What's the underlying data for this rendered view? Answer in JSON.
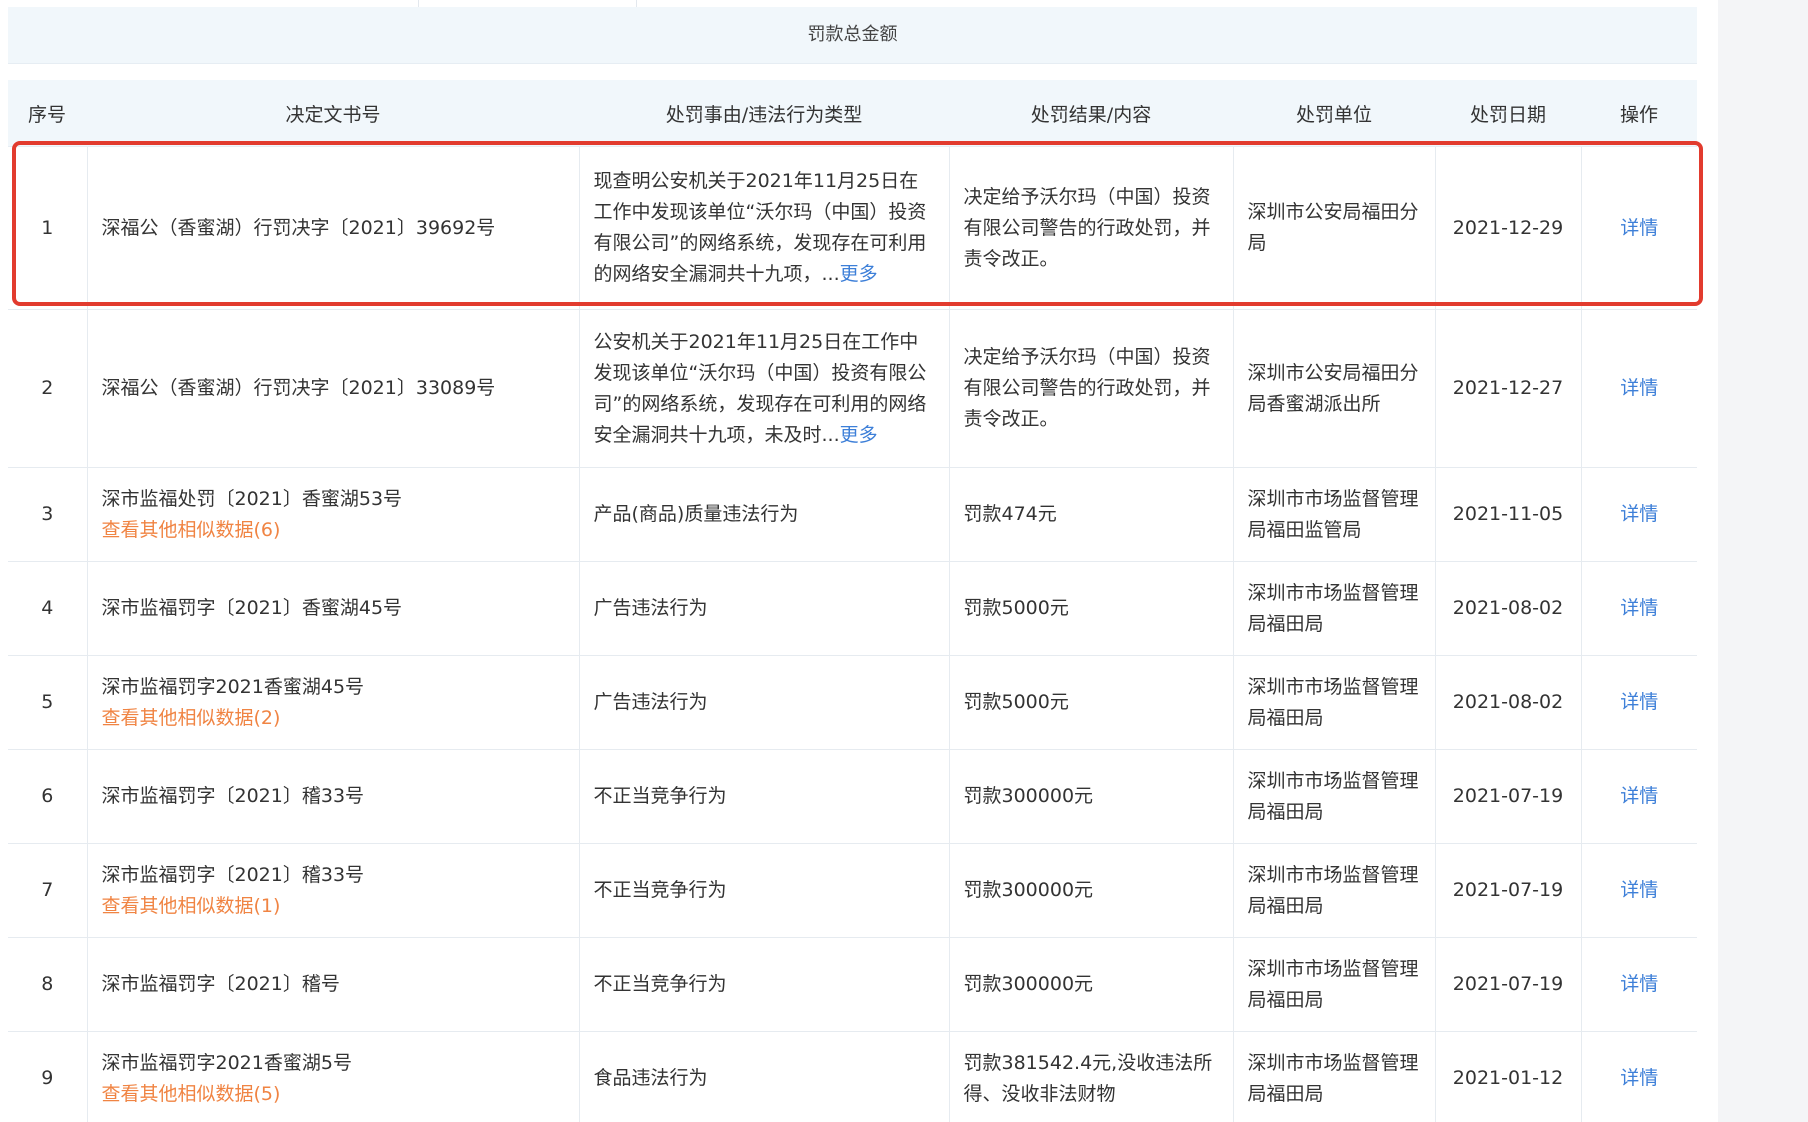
{
  "summary": {
    "total_label": "罚款总金额"
  },
  "table": {
    "headers": {
      "index": "序号",
      "doc_no": "决定文书号",
      "reason": "处罚事由/违法行为类型",
      "result": "处罚结果/内容",
      "unit": "处罚单位",
      "date": "处罚日期",
      "action": "操作"
    },
    "rows": [
      {
        "index": "1",
        "doc_no": "深福公（香蜜湖）行罚决字〔2021〕39692号",
        "similar": "",
        "reason": "现查明公安机关于2021年11月25日在工作中发现该单位“沃尔玛（中国）投资有限公司”的网络系统，发现存在可利用的网络安全漏洞共十九项，",
        "reason_ellipsis": "...",
        "reason_more": "更多",
        "result": "决定给予沃尔玛（中国）投资有限公司警告的行政处罚，并责令改正。",
        "unit": "深圳市公安局福田分局",
        "date": "2021-12-29",
        "action": "详情"
      },
      {
        "index": "2",
        "doc_no": "深福公（香蜜湖）行罚决字〔2021〕33089号",
        "similar": "",
        "reason": "公安机关于2021年11月25日在工作中发现该单位“沃尔玛（中国）投资有限公司”的网络系统，发现存在可利用的网络安全漏洞共十九项，未及时",
        "reason_ellipsis": "...",
        "reason_more": "更多",
        "result": "决定给予沃尔玛（中国）投资有限公司警告的行政处罚，并责令改正。",
        "unit": "深圳市公安局福田分局香蜜湖派出所",
        "date": "2021-12-27",
        "action": "详情"
      },
      {
        "index": "3",
        "doc_no": "深市监福处罚〔2021〕香蜜湖53号",
        "similar": "查看其他相似数据(6)",
        "reason": "产品(商品)质量违法行为",
        "reason_ellipsis": "",
        "reason_more": "",
        "result": "罚款474元",
        "unit": "深圳市市场监督管理局福田监管局",
        "date": "2021-11-05",
        "action": "详情"
      },
      {
        "index": "4",
        "doc_no": "深市监福罚字〔2021〕香蜜湖45号",
        "similar": "",
        "reason": "广告违法行为",
        "reason_ellipsis": "",
        "reason_more": "",
        "result": "罚款5000元",
        "unit": "深圳市市场监督管理局福田局",
        "date": "2021-08-02",
        "action": "详情"
      },
      {
        "index": "5",
        "doc_no": "深市监福罚字2021香蜜湖45号",
        "similar": "查看其他相似数据(2)",
        "reason": "广告违法行为",
        "reason_ellipsis": "",
        "reason_more": "",
        "result": "罚款5000元",
        "unit": "深圳市市场监督管理局福田局",
        "date": "2021-08-02",
        "action": "详情"
      },
      {
        "index": "6",
        "doc_no": "深市监福罚字〔2021〕稽33号",
        "similar": "",
        "reason": "不正当竞争行为",
        "reason_ellipsis": "",
        "reason_more": "",
        "result": "罚款300000元",
        "unit": "深圳市市场监督管理局福田局",
        "date": "2021-07-19",
        "action": "详情"
      },
      {
        "index": "7",
        "doc_no": "深市监福罚字〔2021〕稽33号",
        "similar": "查看其他相似数据(1)",
        "reason": "不正当竞争行为",
        "reason_ellipsis": "",
        "reason_more": "",
        "result": "罚款300000元",
        "unit": "深圳市市场监督管理局福田局",
        "date": "2021-07-19",
        "action": "详情"
      },
      {
        "index": "8",
        "doc_no": "深市监福罚字〔2021〕稽号",
        "similar": "",
        "reason": "不正当竞争行为",
        "reason_ellipsis": "",
        "reason_more": "",
        "result": "罚款300000元",
        "unit": "深圳市市场监督管理局福田局",
        "date": "2021-07-19",
        "action": "详情"
      },
      {
        "index": "9",
        "doc_no": "深市监福罚字2021香蜜湖5号",
        "similar": "查看其他相似数据(5)",
        "reason": "食品违法行为",
        "reason_ellipsis": "",
        "reason_more": "",
        "result": "罚款381542.4元,没收违法所得、没收非法财物",
        "unit": "深圳市市场监督管理局福田局",
        "date": "2021-01-12",
        "action": "详情"
      }
    ]
  },
  "colors": {
    "header_bg": "#f1f7fb",
    "link_blue": "#3d7fd8",
    "link_orange": "#f08443",
    "highlight_red": "#e23b2e"
  }
}
